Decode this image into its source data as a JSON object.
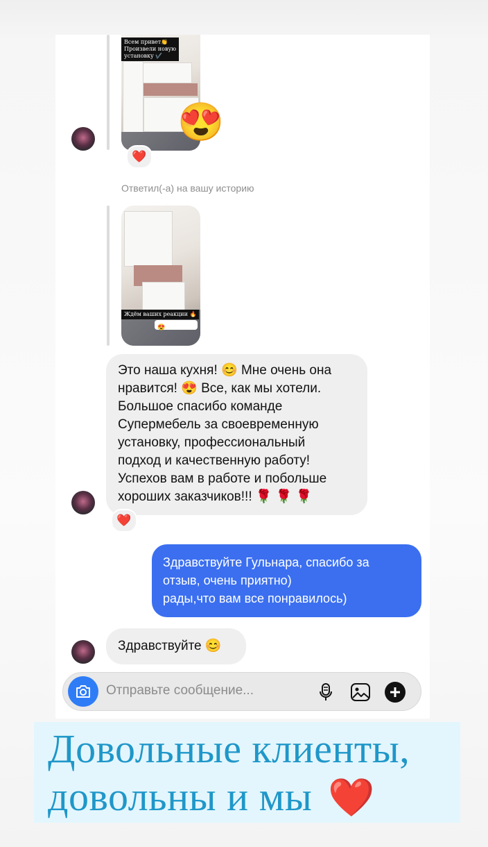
{
  "stories": [
    {
      "caption_lines": [
        "Всем привет👏",
        "Произвели новую",
        "установку ✔️"
      ],
      "reaction": "😍"
    },
    {
      "caption": "Ждём ваших реакции 🔥",
      "sticker": "😍"
    }
  ],
  "system_text": "Ответил(-а) на вашу историю",
  "reactions": [
    "❤️",
    "❤️"
  ],
  "messages": {
    "review_lines": [
      "Это наша кухня! 😊 Мне очень она",
      "нравится! 😍 Все, как мы хотели.",
      "Большое спасибо команде",
      "Супермебель за своевременную",
      "установку, профессиональный",
      "подход и качественную работу!",
      "Успехов вам в работе и побольше",
      "хороших заказчиков!!! 🌹 🌹 🌹"
    ],
    "reply_lines": [
      "Здравствуйте Гульнара, спасибо за",
      "отзыв, очень приятно)",
      "рады,что вам все понравилось)"
    ],
    "greeting": "Здравствуйте 😊"
  },
  "composer": {
    "placeholder": "Отправьте сообщение...",
    "icons": [
      "camera-icon",
      "microphone-icon",
      "gallery-icon",
      "plus-icon"
    ]
  },
  "banner": {
    "line1": "Довольные клиенты,",
    "line2": "довольны и мы",
    "heart": "❤️",
    "background": "#e3f6fd",
    "text_color": "#1f97c9"
  },
  "colors": {
    "outgoing_bubble": "#3b6ff0",
    "incoming_bubble": "#efefef",
    "camera_button": "#2f7df6"
  }
}
